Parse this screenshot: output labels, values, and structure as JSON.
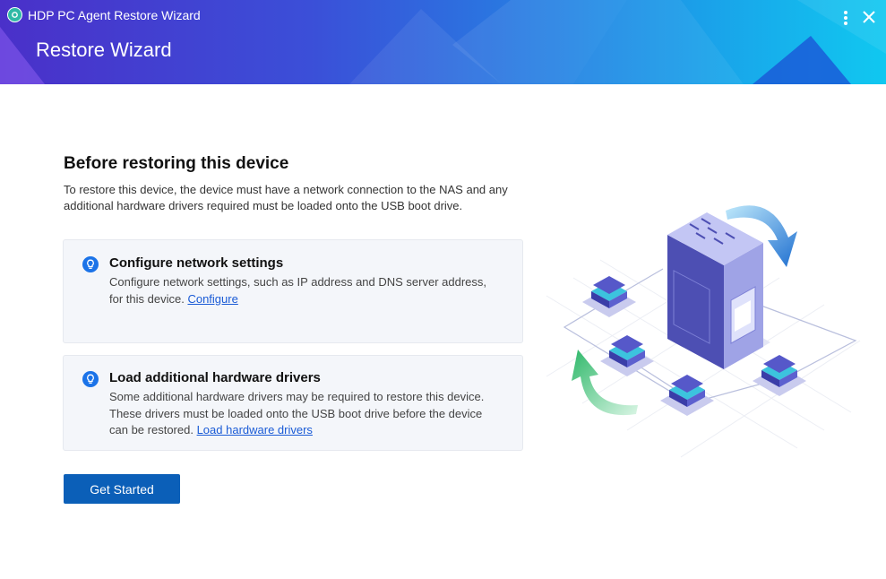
{
  "window": {
    "app_title": "HDP PC Agent Restore Wizard",
    "wizard_title": "Restore Wizard",
    "icons": {
      "app": "app-logo-icon",
      "menu": "more-vertical-icon",
      "close": "close-icon"
    }
  },
  "main": {
    "heading": "Before restoring this device",
    "description": "To restore this device, the device must have a network connection to the NAS and any additional hardware drivers required must be loaded onto the USB boot drive.",
    "cards": [
      {
        "icon": "lightbulb-icon",
        "title": "Configure network settings",
        "text": "Configure network settings, such as IP address and DNS server address, for this device.",
        "link": "Configure"
      },
      {
        "icon": "lightbulb-icon",
        "title": "Load additional hardware drivers",
        "text": "Some additional hardware drivers may be required to restore this device. These drivers must be loaded onto the USB boot drive before the device can be restored.",
        "link": "Load hardware drivers"
      }
    ],
    "primary_button": "Get Started"
  },
  "colors": {
    "header_gradient_start": "#4a30c9",
    "header_gradient_end": "#10c8f0",
    "primary_button": "#0b5fb8",
    "link": "#1a5bd6",
    "card_background": "#f4f6fa"
  }
}
